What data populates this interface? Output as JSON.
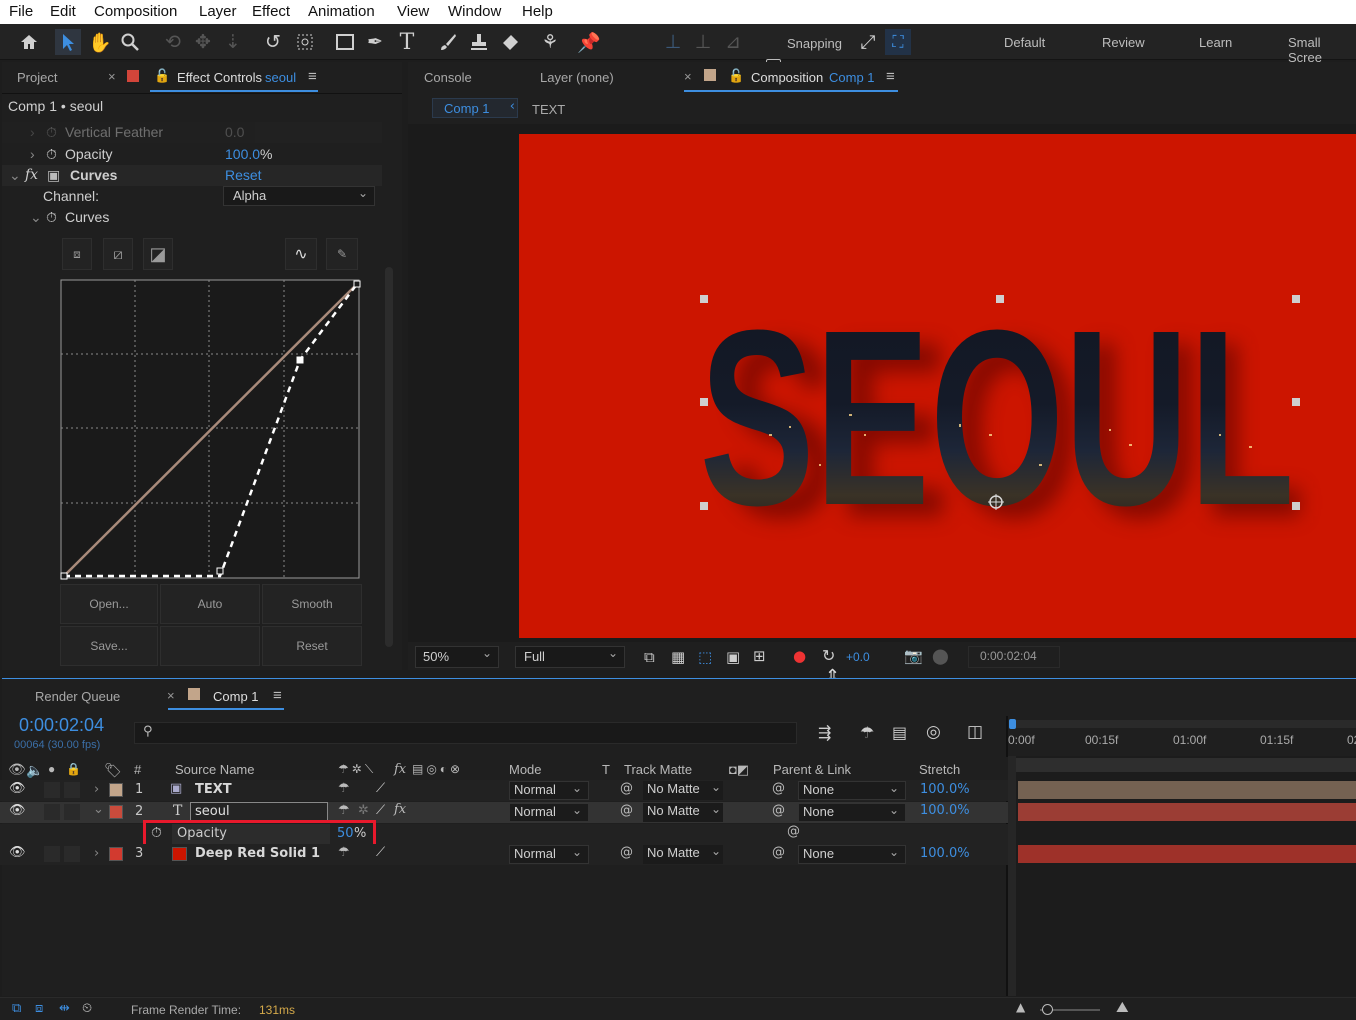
{
  "menu": [
    "File",
    "Edit",
    "Composition",
    "Layer",
    "Effect",
    "Animation",
    "View",
    "Window",
    "Help"
  ],
  "toolbar": {
    "snapping_label": "Snapping",
    "workspaces": [
      "Default",
      "Review",
      "Learn",
      "Small Scree"
    ]
  },
  "project_panel": {
    "tab_project": "Project",
    "tab_effect_controls": "Effect Controls",
    "effect_controls_target": "seoul",
    "breadcrumb": "Comp 1 • seoul"
  },
  "effects": {
    "vertical_feather": {
      "label": "Vertical Feather",
      "value": "0.0"
    },
    "opacity": {
      "label": "Opacity",
      "value": "100.0",
      "unit": "%"
    },
    "curves": {
      "fx": "fx",
      "label": "Curves",
      "reset": "Reset",
      "channel_label": "Channel:",
      "channel_value": "Alpha",
      "curves_sub_label": "Curves"
    },
    "curve_buttons": {
      "open": "Open...",
      "auto": "Auto",
      "smooth": "Smooth",
      "save": "Save...",
      "reset": "Reset"
    }
  },
  "viewer_panel": {
    "tab_console": "Console",
    "tab_layer": "Layer (none)",
    "tab_composition": "Composition",
    "composition_name": "Comp 1",
    "breadcrumb_comp": "Comp 1",
    "breadcrumb_layer": "TEXT"
  },
  "artwork": {
    "word": "SEOUL",
    "background_color": "#cc1500",
    "text_color": "#151a26"
  },
  "viewer_footer": {
    "zoom": "50%",
    "resolution": "Full",
    "exposure": "+0.0",
    "timecode": "0:00:02:04"
  },
  "timeline": {
    "tab_render_queue": "Render Queue",
    "tab_comp": "Comp 1",
    "timecode": "0:00:02:04",
    "frame_info": "00064 (30.00 fps)",
    "search_placeholder": "",
    "headers": {
      "num": "#",
      "source_name": "Source Name",
      "mode": "Mode",
      "t": "T",
      "track_matte": "Track Matte",
      "parent_link": "Parent & Link",
      "stretch": "Stretch"
    },
    "ruler": [
      "0:00f",
      "00:15f",
      "01:00f",
      "01:15f",
      "02"
    ],
    "layers": [
      {
        "num": "1",
        "name": "TEXT",
        "mode": "Normal",
        "matte": "No Matte",
        "parent": "None",
        "stretch": "100.0%",
        "label_color": "#c2a58a"
      },
      {
        "num": "2",
        "name": "seoul",
        "mode": "Normal",
        "matte": "No Matte",
        "parent": "None",
        "stretch": "100.0%",
        "label_color": "#c94b3c"
      },
      {
        "num": "3",
        "name": "Deep Red Solid 1",
        "mode": "Normal",
        "matte": "No Matte",
        "parent": "None",
        "stretch": "100.0%",
        "label_color": "#d23a2f"
      }
    ],
    "property": {
      "label": "Opacity",
      "value": "50",
      "unit": "%"
    },
    "frame_render_label": "Frame Render Time:",
    "frame_render_value": "131ms"
  },
  "colors": {
    "accent": "#3d8ee0",
    "highlight_box": "#e8192c"
  }
}
